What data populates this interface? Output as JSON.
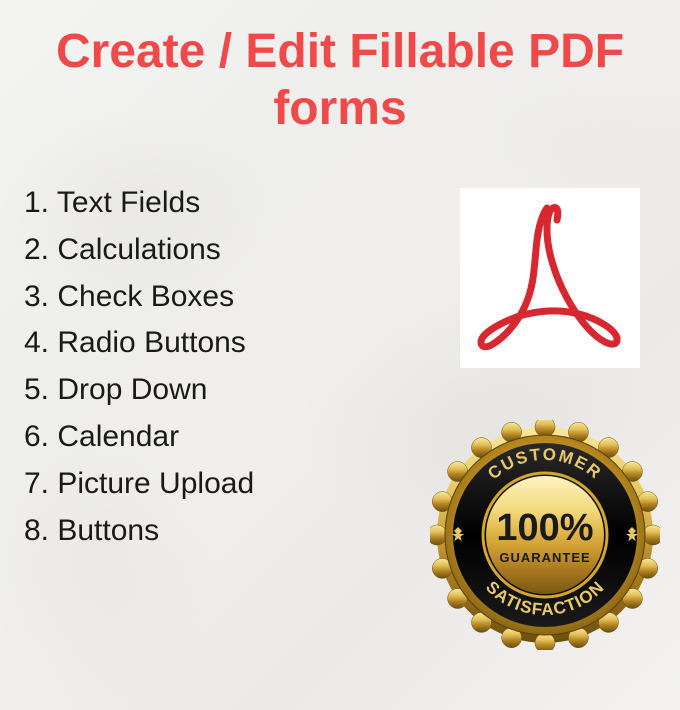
{
  "title_line1": "Create / Edit Fillable PDF",
  "title_line2": "forms",
  "features": {
    "item1": "1. Text Fields",
    "item2": "2. Calculations",
    "item3": "3. Check Boxes",
    "item4": "4. Radio Buttons",
    "item5": "5. Drop Down",
    "item6": "6. Calendar",
    "item7": "7. Picture Upload",
    "item8": "8. Buttons"
  },
  "badge": {
    "top_arc": "CUSTOMER",
    "bottom_arc": "SATISFACTION",
    "main": "100%",
    "sub": "GUARANTEE"
  },
  "colors": {
    "title": "#ef4a49",
    "adobe_red": "#d8282f",
    "gold_dark": "#8a6a1a",
    "gold_mid": "#d4a72c",
    "gold_light": "#f5e08a",
    "black": "#0a0a0a"
  }
}
